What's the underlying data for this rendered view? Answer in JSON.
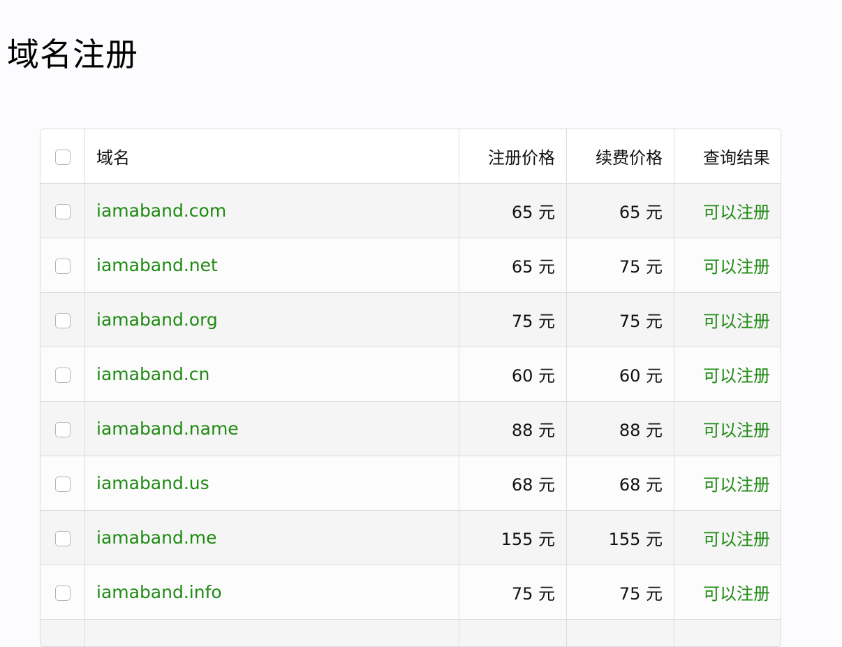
{
  "page": {
    "title": "域名注册",
    "accent_color": "#1e8a12"
  },
  "table": {
    "headers": {
      "domain": "域名",
      "register_price": "注册价格",
      "renew_price": "续费价格",
      "result": "查询结果"
    },
    "rows": [
      {
        "domain": "iamaband.com",
        "register_price": "65 元",
        "renew_price": "65 元",
        "result": "可以注册"
      },
      {
        "domain": "iamaband.net",
        "register_price": "65 元",
        "renew_price": "75 元",
        "result": "可以注册"
      },
      {
        "domain": "iamaband.org",
        "register_price": "75 元",
        "renew_price": "75 元",
        "result": "可以注册"
      },
      {
        "domain": "iamaband.cn",
        "register_price": "60 元",
        "renew_price": "60 元",
        "result": "可以注册"
      },
      {
        "domain": "iamaband.name",
        "register_price": "88 元",
        "renew_price": "88 元",
        "result": "可以注册"
      },
      {
        "domain": "iamaband.us",
        "register_price": "68 元",
        "renew_price": "68 元",
        "result": "可以注册"
      },
      {
        "domain": "iamaband.me",
        "register_price": "155 元",
        "renew_price": "155 元",
        "result": "可以注册"
      },
      {
        "domain": "iamaband.info",
        "register_price": "75 元",
        "renew_price": "75 元",
        "result": "可以注册"
      },
      {
        "domain": "",
        "register_price": "",
        "renew_price": "",
        "result": ""
      }
    ]
  }
}
